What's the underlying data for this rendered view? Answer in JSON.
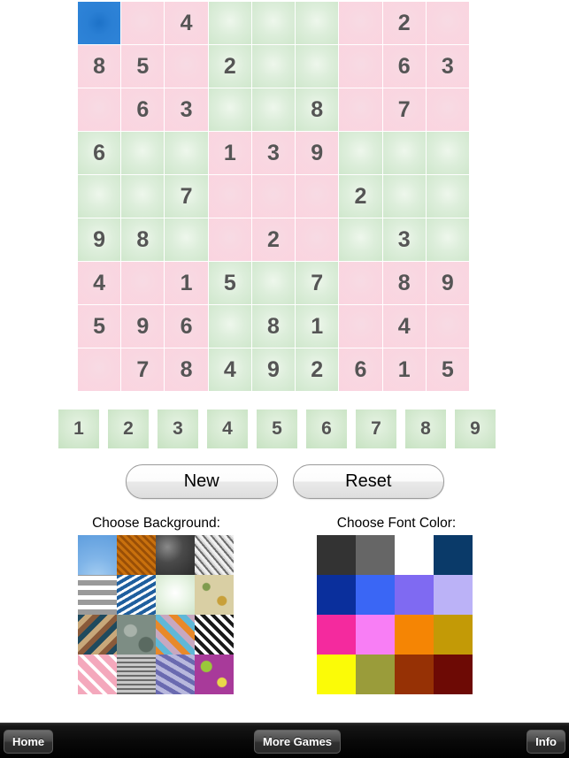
{
  "board": {
    "rows": [
      [
        "",
        "",
        "4",
        "",
        "",
        "",
        "",
        "2",
        ""
      ],
      [
        "8",
        "5",
        "",
        "2",
        "",
        "",
        "",
        "6",
        "3"
      ],
      [
        "",
        "6",
        "3",
        "",
        "",
        "8",
        "",
        "7",
        ""
      ],
      [
        "6",
        "",
        "",
        "1",
        "3",
        "9",
        "",
        "",
        ""
      ],
      [
        "",
        "",
        "7",
        "",
        "",
        "",
        "2",
        "",
        ""
      ],
      [
        "9",
        "8",
        "",
        "",
        "2",
        "",
        "",
        "3",
        ""
      ],
      [
        "4",
        "",
        "1",
        "5",
        "",
        "7",
        "",
        "8",
        "9"
      ],
      [
        "5",
        "9",
        "6",
        "",
        "8",
        "1",
        "",
        "4",
        ""
      ],
      [
        "",
        "7",
        "8",
        "4",
        "9",
        "2",
        "6",
        "1",
        "5"
      ]
    ],
    "selected_cell": {
      "row": 0,
      "col": 0
    },
    "colors": {
      "pink_box": "#fad4e0",
      "green_box": "#cfe7cc",
      "selected": "#2a7fd4",
      "digit": "#555555"
    }
  },
  "numpad": {
    "keys": [
      "1",
      "2",
      "3",
      "4",
      "5",
      "6",
      "7",
      "8",
      "9"
    ]
  },
  "actions": {
    "new_label": "New",
    "reset_label": "Reset"
  },
  "background_chooser": {
    "title": "Choose Background:",
    "swatches": [
      {
        "name": "blue-sky-rays",
        "colors": [
          "#7fb4e8",
          "#a9d0f2",
          "#5f9ede"
        ]
      },
      {
        "name": "orange-wood-weave",
        "colors": [
          "#c8700d",
          "#9a4f06",
          "#e08a21"
        ]
      },
      {
        "name": "dark-gray-clouds",
        "colors": [
          "#4a4a4a",
          "#8a8a8a",
          "#2a2a2a"
        ]
      },
      {
        "name": "diagonal-gray-stripes",
        "colors": [
          "#d8d8d8",
          "#6b6b6b",
          "#f0f0f0"
        ]
      },
      {
        "name": "gray-interlock-links",
        "colors": [
          "#9a9a9a",
          "#ffffff",
          "#7d7d7d"
        ]
      },
      {
        "name": "blue-chevron-zigzag",
        "colors": [
          "#1f5f9e",
          "#ffffff",
          "#2d76bd"
        ]
      },
      {
        "name": "light-green-gradient",
        "colors": [
          "#e9f5e6",
          "#ffffff",
          "#cfe3c8"
        ]
      },
      {
        "name": "beige-floral-bee",
        "colors": [
          "#d9cfa4",
          "#c8a03a",
          "#7f9b4e"
        ]
      },
      {
        "name": "southwest-zigzag",
        "colors": [
          "#1f4a5e",
          "#c8a87a",
          "#8a5a3a"
        ]
      },
      {
        "name": "gray-floral-leaves",
        "colors": [
          "#7d8d84",
          "#5a6a61",
          "#a8b2aa"
        ]
      },
      {
        "name": "octagon-color-tiles",
        "colors": [
          "#e8892a",
          "#5fb8d8",
          "#c8a8c0"
        ]
      },
      {
        "name": "black-white-diamonds",
        "colors": [
          "#ffffff",
          "#1a1a1a",
          "#d8d8d8"
        ]
      },
      {
        "name": "pink-hearts-lattice",
        "colors": [
          "#f4a8bc",
          "#ffffff",
          "#e8697f"
        ]
      },
      {
        "name": "gray-maze-squares",
        "colors": [
          "#c8c8c8",
          "#6a6a6a",
          "#f0f0f0"
        ]
      },
      {
        "name": "blue-purple-swirls",
        "colors": [
          "#6a6ab0",
          "#b8b8dd",
          "#3f3f8a"
        ]
      },
      {
        "name": "purple-leaf-floral",
        "colors": [
          "#a83a9a",
          "#9ac83a",
          "#e8d84a"
        ]
      }
    ]
  },
  "font_color_chooser": {
    "title": "Choose Font Color:",
    "swatches": [
      {
        "name": "charcoal",
        "hex": "#333333"
      },
      {
        "name": "gray",
        "hex": "#666666"
      },
      {
        "name": "white",
        "hex": "#ffffff"
      },
      {
        "name": "navy",
        "hex": "#0a3a69"
      },
      {
        "name": "dark-blue",
        "hex": "#0a2f9c"
      },
      {
        "name": "royal-blue",
        "hex": "#3a66f5"
      },
      {
        "name": "violet",
        "hex": "#7f6af2"
      },
      {
        "name": "light-lavender",
        "hex": "#bbb2f7"
      },
      {
        "name": "magenta",
        "hex": "#f42a9e"
      },
      {
        "name": "pink",
        "hex": "#f87ef5"
      },
      {
        "name": "orange",
        "hex": "#f58504"
      },
      {
        "name": "dark-gold",
        "hex": "#c39a06"
      },
      {
        "name": "yellow",
        "hex": "#fbfb07"
      },
      {
        "name": "olive",
        "hex": "#9a9c3a"
      },
      {
        "name": "rust",
        "hex": "#963105"
      },
      {
        "name": "dark-maroon",
        "hex": "#6d0a05"
      }
    ]
  },
  "toolbar": {
    "home_label": "Home",
    "more_games_label": "More Games",
    "info_label": "Info"
  }
}
